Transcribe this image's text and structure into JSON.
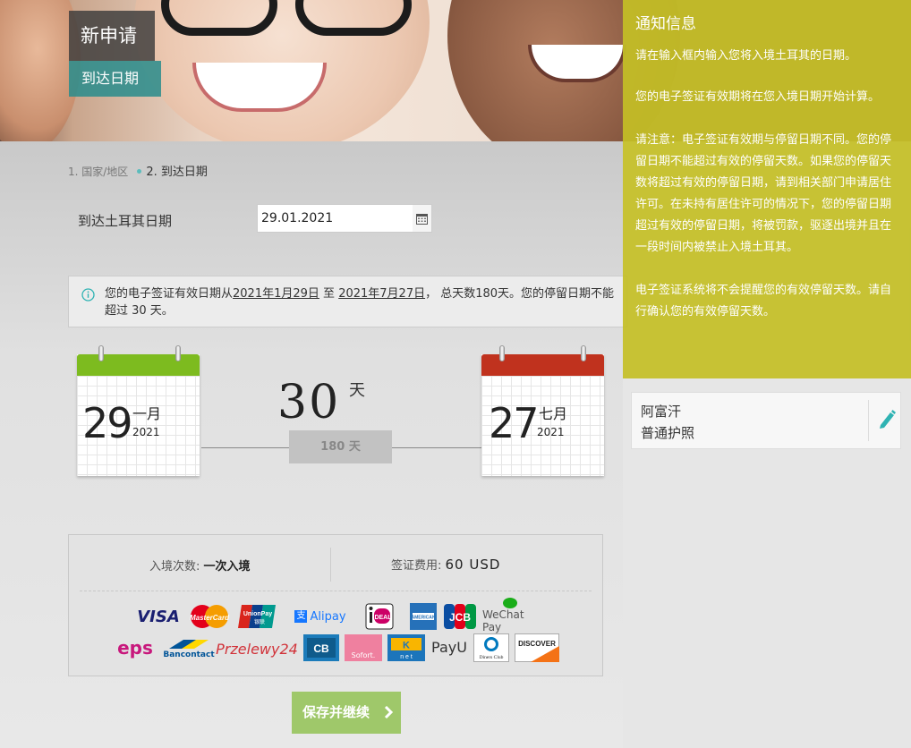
{
  "header": {
    "title": "新申请",
    "subtitle": "到达日期"
  },
  "notice": {
    "title": "通知信息",
    "paragraphs": [
      "请在输入框内输入您将入境土耳其的日期。",
      "您的电子签证有效期将在您入境日期开始计算。",
      "请注意：电子签证有效期与停留日期不同。您的停留日期不能超过有效的停留天数。如果您的停留天数将超过有效的停留日期，请到相关部门申请居住许可。在未持有居住许可的情况下，您的停留日期超过有效的停留日期，将被罚款，驱逐出境并且在一段时间内被禁止入境土耳其。",
      "电子签证系统将不会提醒您的有效停留天数。请自行确认您的有效停留天数。"
    ]
  },
  "applicant": {
    "country": "阿富汗",
    "passport": "普通护照"
  },
  "breadcrumb": {
    "step1": "1. 国家/地区",
    "step2": "2. 到达日期"
  },
  "arrival": {
    "label": "到达土耳其日期",
    "value": "29.01.2021"
  },
  "info": {
    "prefix": "您的电子签证有效日期从",
    "start": "2021年1月29日",
    "middle": " 至 ",
    "end": "2021年7月27日",
    "suffix": "， 总天数180天。您的停留日期不能超过 30 天。"
  },
  "calendar": {
    "start": {
      "day": "29",
      "month": "一月",
      "year": "2021",
      "color": "#7dbb1f"
    },
    "end": {
      "day": "27",
      "month": "七月",
      "year": "2021",
      "color": "#c0321e"
    },
    "stay_days": "30",
    "stay_unit": "天",
    "total": "180 天"
  },
  "fees": {
    "entries_label": "入境次数: ",
    "entries_value": "一次入境",
    "fee_label": "签证费用: ",
    "fee_value": "60 USD"
  },
  "payment_methods": [
    "VISA",
    "MasterCard",
    "UnionPay",
    "Alipay",
    "iDEAL",
    "AmEx",
    "JCB",
    "WeChat Pay",
    "eps",
    "Bancontact",
    "Przelewy24",
    "CB",
    "Sofort.",
    "K net",
    "PayU",
    "Diners Club",
    "DISCOVER"
  ],
  "actions": {
    "continue": "保存并继续"
  },
  "colors": {
    "accent": "#5bbcbc",
    "notice_bg": "#c4be26",
    "cta": "#9fc86a"
  }
}
